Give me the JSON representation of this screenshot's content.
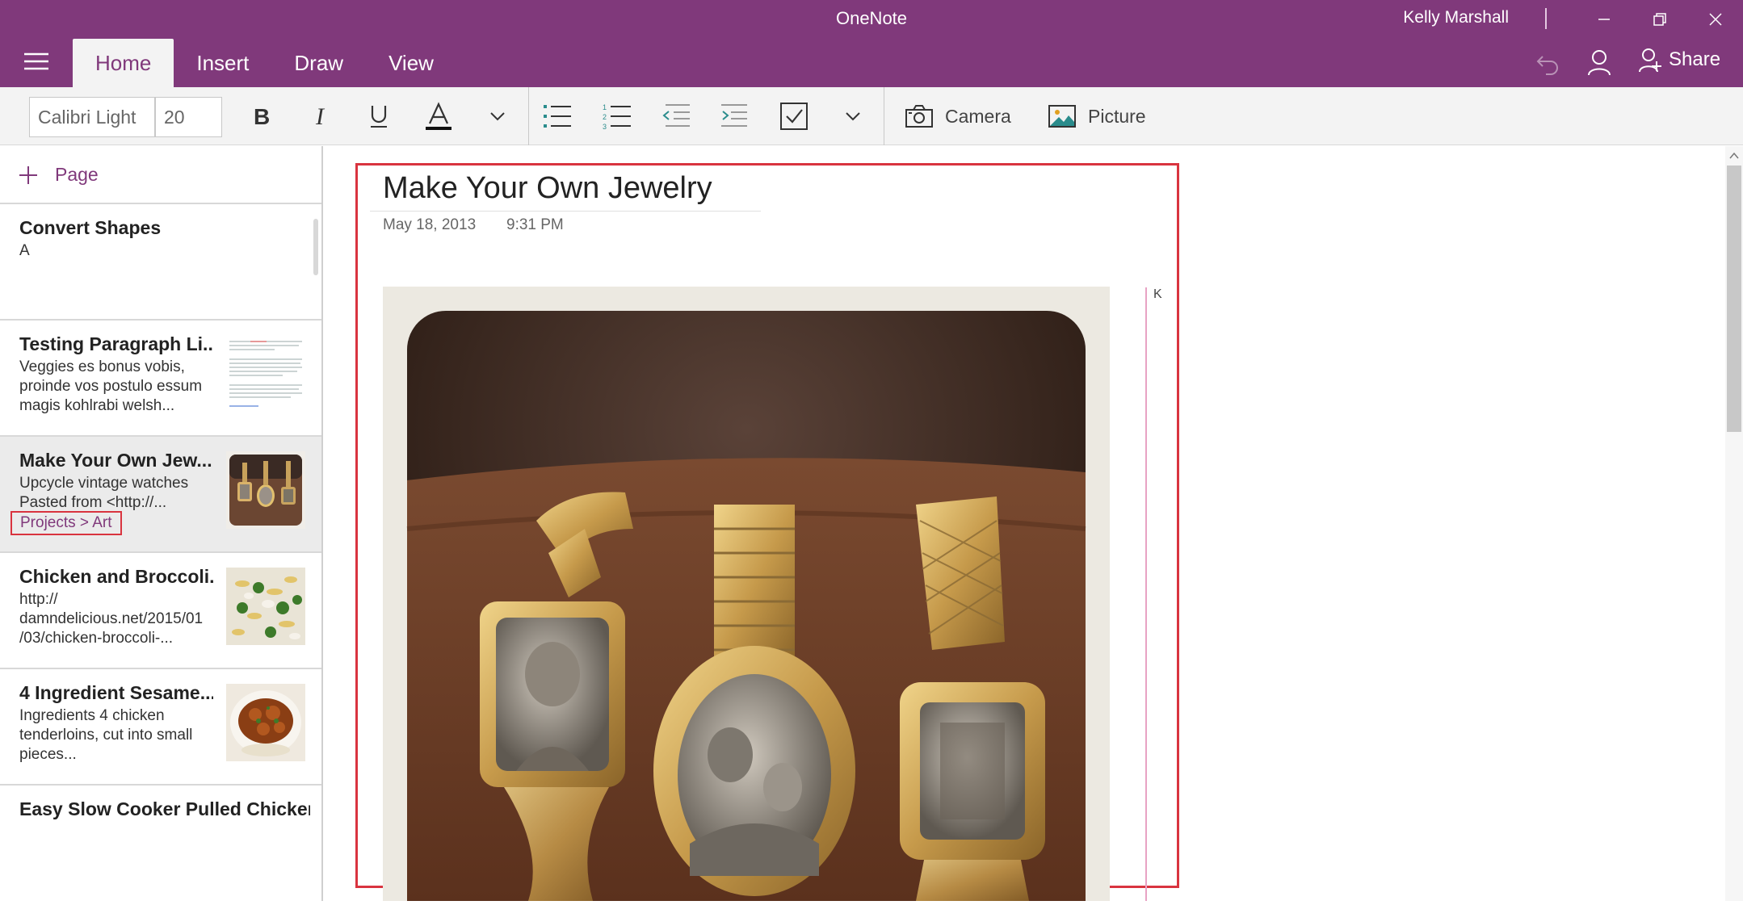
{
  "window": {
    "title": "OneNote",
    "user": "Kelly Marshall"
  },
  "tabs": [
    "Home",
    "Insert",
    "Draw",
    "View"
  ],
  "header_actions": {
    "share_label": "Share"
  },
  "ribbon": {
    "font_name": "Calibri Light",
    "font_size": "20",
    "camera_label": "Camera",
    "picture_label": "Picture"
  },
  "sidebar": {
    "add_page_label": "Page",
    "pages": [
      {
        "title": "Convert Shapes",
        "preview": "A"
      },
      {
        "title": "Testing Paragraph Li...",
        "preview": "Veggies es bonus vobis, proinde vos postulo essum magis kohlrabi welsh..."
      },
      {
        "title": "Make Your Own Jew...",
        "preview": "Upcycle vintage watches Pasted from <http://...",
        "tag": "Projects > Art"
      },
      {
        "title": "Chicken and Broccoli...",
        "preview": "http:// damndelicious.net/2015/01 /03/chicken-broccoli-..."
      },
      {
        "title": "4 Ingredient Sesame...",
        "preview": "Ingredients 4 chicken tenderloins, cut into small pieces..."
      },
      {
        "title": "Easy Slow Cooker Pulled Chicken",
        "preview": ""
      }
    ]
  },
  "note": {
    "title": "Make Your Own Jewelry",
    "date": "May 18, 2013",
    "time": "9:31 PM",
    "side_text": "K"
  },
  "colors": {
    "accent": "#80397b",
    "highlight_border": "#d9343f"
  }
}
